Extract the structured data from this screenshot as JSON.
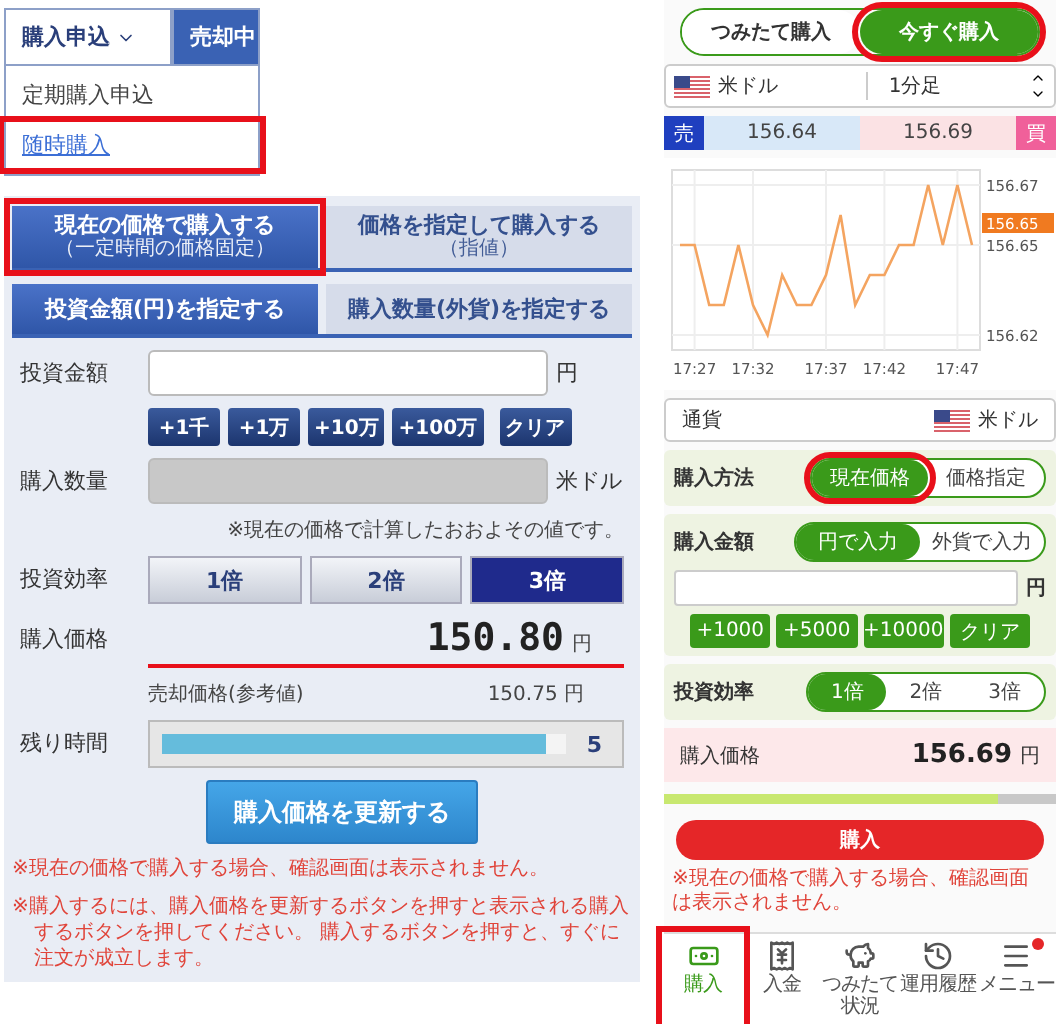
{
  "menu": {
    "tabs": [
      {
        "label": "購入申込",
        "selected": true
      },
      {
        "label": "売却中",
        "selected": false
      }
    ],
    "dropdown_items": [
      {
        "label": "定期購入申込",
        "selected": false,
        "highlighted": false
      },
      {
        "label": "随時購入",
        "selected": true,
        "highlighted": true
      }
    ]
  },
  "order_form": {
    "method_tabs": [
      {
        "title": "現在の価格で購入する",
        "subtitle": "（一定時間の価格固定）",
        "selected": true,
        "highlighted": true
      },
      {
        "title": "価格を指定して購入する",
        "subtitle": "（指値）",
        "selected": false,
        "highlighted": false
      }
    ],
    "amount_tabs": [
      {
        "label": "投資金額(円)を指定する",
        "selected": true
      },
      {
        "label": "購入数量(外貨)を指定する",
        "selected": false
      }
    ],
    "investment": {
      "label": "投資金額",
      "unit": "円",
      "buttons": [
        "+1千",
        "+1万",
        "+10万",
        "+100万",
        "クリア"
      ]
    },
    "quantity": {
      "label": "購入数量",
      "unit": "米ドル",
      "disabled": true,
      "note": "※現在の価格で計算したおおよその値です。"
    },
    "leverage": {
      "label": "投資効率",
      "options": [
        {
          "label": "1倍",
          "selected": false
        },
        {
          "label": "2倍",
          "selected": false
        },
        {
          "label": "3倍",
          "selected": true
        }
      ]
    },
    "price": {
      "label": "購入価格",
      "value": "150.80",
      "unit": "円",
      "sell_label": "売却価格(参考値)",
      "sell_value": "150.75",
      "sell_unit": "円"
    },
    "timer": {
      "label": "残り時間",
      "level": 0.95,
      "reading": "5"
    },
    "refresh_button": "購入価格を更新する",
    "notes": [
      "※現在の価格で購入する場合、確認画面は表示されません。",
      "※購入するには、購入価格を更新するボタンを押すと表示される購入するボタンを押してください。 購入するボタンを押すと、すぐに注文が成立します。"
    ]
  },
  "app": {
    "mode_toggle": [
      {
        "label": "つみたて購入",
        "selected": false,
        "highlighted": false
      },
      {
        "label": "今すぐ購入",
        "selected": true,
        "highlighted": true
      }
    ],
    "pair_select": {
      "currency": "米ドル",
      "interval": "1分足"
    },
    "quote": {
      "sell_label": "売",
      "sell": "156.64",
      "buy": "156.69",
      "buy_label": "買"
    },
    "chart": {
      "current_tag": "156.65",
      "chart_data": {
        "type": "line",
        "categories": [
          null,
          "17:27",
          null,
          null,
          null,
          "17:32",
          null,
          null,
          null,
          null,
          "17:37",
          null,
          null,
          null,
          "17:42",
          null,
          null,
          null,
          null,
          "17:47",
          null
        ],
        "series": [
          {
            "color": "#f4a460",
            "values": [
              156.65,
              156.65,
              156.63,
              156.63,
              156.65,
              156.63,
              156.62,
              156.64,
              156.63,
              156.63,
              156.64,
              156.66,
              156.63,
              156.64,
              156.64,
              156.65,
              156.65,
              156.67,
              156.65,
              156.67,
              156.65
            ]
          }
        ],
        "ylim": [
          156.615,
          156.675
        ],
        "yticks": [
          156.62,
          156.65,
          156.67
        ],
        "grid": true
      }
    },
    "currency_row": {
      "label": "通貨",
      "value": "米ドル"
    },
    "method": {
      "label": "購入方法",
      "options": [
        {
          "label": "現在価格",
          "selected": true,
          "highlighted": true
        },
        {
          "label": "価格指定",
          "selected": false,
          "highlighted": false
        }
      ]
    },
    "amount": {
      "label": "購入金額",
      "options": [
        {
          "label": "円で入力",
          "selected": true
        },
        {
          "label": "外貨で入力",
          "selected": false
        }
      ],
      "unit": "円",
      "buttons": [
        "+1000",
        "+5000",
        "+10000",
        "クリア"
      ]
    },
    "leverage": {
      "label": "投資効率",
      "options": [
        {
          "label": "1倍",
          "selected": true
        },
        {
          "label": "2倍",
          "selected": false
        },
        {
          "label": "3倍",
          "selected": false
        }
      ]
    },
    "price": {
      "label": "購入価格",
      "value": "156.69",
      "unit": "円"
    },
    "progress": {
      "level": 0.85
    },
    "buy_button": "購入",
    "note": "※現在の価格で購入する場合、確認画面は表示されません。",
    "nav": [
      {
        "kind": "buy",
        "label": "購入",
        "selected": true,
        "highlighted": true,
        "badge": false
      },
      {
        "kind": "deposit",
        "label": "入金",
        "selected": false,
        "highlighted": false,
        "badge": false
      },
      {
        "kind": "savings",
        "label": "つみたて状況",
        "selected": false,
        "highlighted": false,
        "badge": false
      },
      {
        "kind": "history",
        "label": "運用履歴",
        "selected": false,
        "highlighted": false,
        "badge": false
      },
      {
        "kind": "menu",
        "label": "メニュー",
        "selected": false,
        "highlighted": false,
        "badge": true
      }
    ]
  }
}
